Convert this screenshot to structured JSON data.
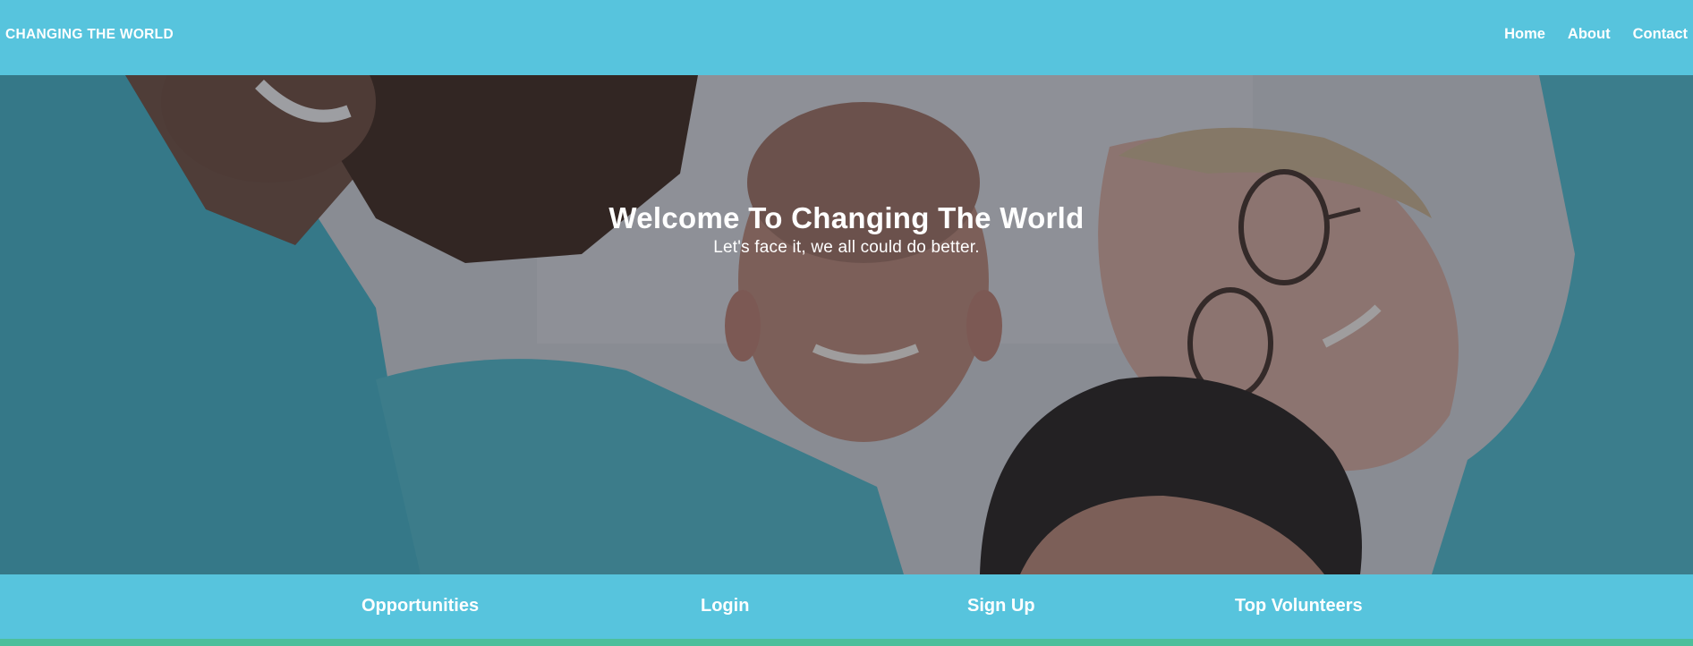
{
  "header": {
    "brand": "CHANGING THE WORLD",
    "nav": [
      {
        "label": "Home"
      },
      {
        "label": "About"
      },
      {
        "label": "Contact"
      }
    ]
  },
  "hero": {
    "title": "Welcome To Changing The World",
    "subtitle": "Let's face it, we all could do better.",
    "image": "volunteers-group-photo"
  },
  "footer_nav": [
    {
      "label": "Opportunities"
    },
    {
      "label": "Login"
    },
    {
      "label": "Sign Up"
    },
    {
      "label": "Top Volunteers"
    }
  ],
  "colors": {
    "primary": "#57c4dd",
    "accent_strip": "#4cbf9b",
    "text": "#ffffff"
  }
}
